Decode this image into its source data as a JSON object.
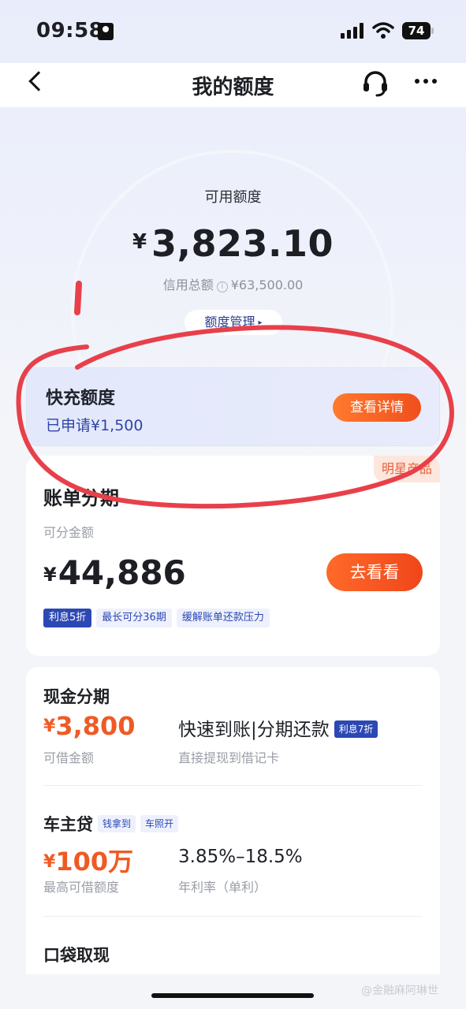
{
  "status_bar": {
    "time": "09:58",
    "battery": "74"
  },
  "nav": {
    "title": "我的额度"
  },
  "quota": {
    "label": "可用额度",
    "currency": "¥",
    "amount": "3,823.10",
    "credit_total_label": "信用总额",
    "credit_total_value": "¥63,500.00",
    "manage_label": "额度管理",
    "manage_caret": "▸"
  },
  "quick_recharge": {
    "title": "快充额度",
    "subtitle": "已申请¥1,500",
    "button_label": "查看详情"
  },
  "bill_installment": {
    "badge": "明星产品",
    "title": "账单分期",
    "subtitle": "可分金额",
    "currency": "¥",
    "amount": "44,886",
    "button_label": "去看看",
    "tags": [
      "利息5折",
      "最长可分36期",
      "缓解账单还款压力"
    ]
  },
  "cash_installment": {
    "title": "现金分期",
    "currency": "¥",
    "amount": "3,800",
    "caption": "可借金额",
    "headline": "快速到账|分期还款",
    "headline_tag": "利息7折",
    "headline_sub": "直接提现到借记卡"
  },
  "car_loan": {
    "title": "车主贷",
    "tags": [
      "钱拿到",
      "车照开"
    ],
    "currency": "¥",
    "amount": "100万",
    "caption": "最高可借额度",
    "rate": "3.85%–18.5%",
    "rate_caption": "年利率（单利）"
  },
  "pocket_cash": {
    "title": "口袋取现"
  },
  "watermark": "@金融麻阿琳世",
  "colors": {
    "accent_orange": "#f04f1c",
    "brand_blue": "#2c48b4",
    "annotation_red": "#e8404a"
  },
  "icons": {
    "back": "back-chevron-icon",
    "headset": "headset-icon",
    "more": "more-icon",
    "info": "info-icon"
  }
}
